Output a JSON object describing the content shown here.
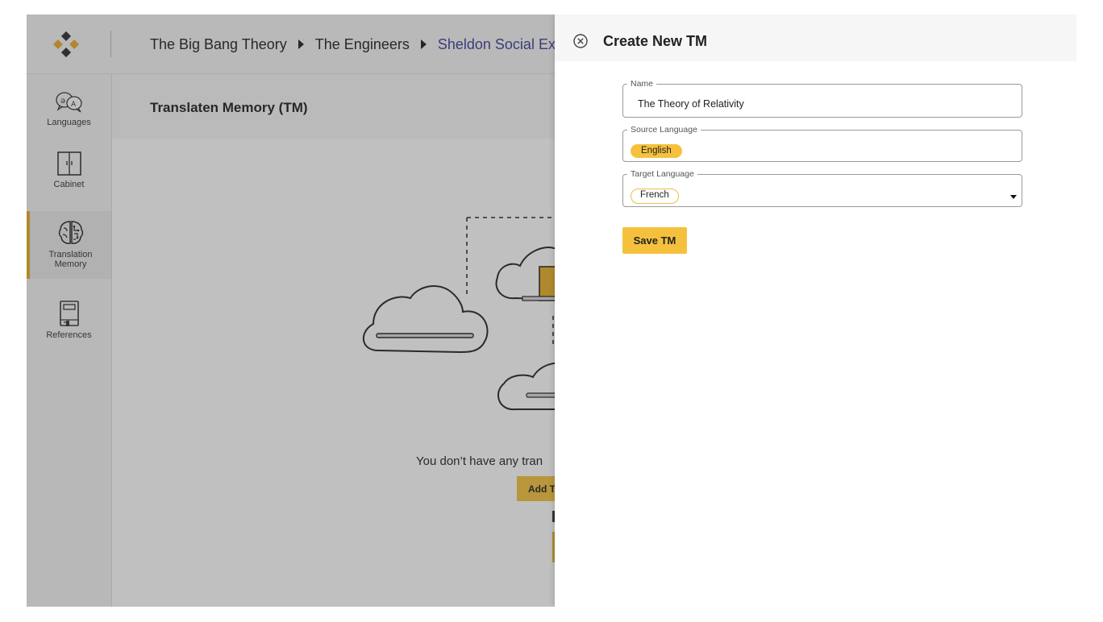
{
  "breadcrumb": {
    "items": [
      "The Big Bang Theory",
      "The Engineers",
      "Sheldon Social Ex"
    ]
  },
  "sidebar": {
    "items": [
      {
        "label": "Languages",
        "icon": "languages-icon"
      },
      {
        "label": "Cabinet",
        "icon": "cabinet-icon"
      },
      {
        "label": "Translation Memory",
        "icon": "brain-circuit-icon",
        "active": true
      },
      {
        "label": "References",
        "icon": "book-icon"
      }
    ]
  },
  "content": {
    "title": "Translaten Memory (TM)",
    "empty_text": "You don’t have any tran",
    "add_button_label": "Add T"
  },
  "drawer": {
    "title": "Create New TM",
    "fields": {
      "name": {
        "label": "Name",
        "value": "The Theory of Relativity"
      },
      "source_language": {
        "label": "Source Language",
        "value": "English"
      },
      "target_language": {
        "label": "Target Language",
        "value": "French"
      }
    },
    "save_label": "Save TM"
  },
  "colors": {
    "accent": "#f5c13d",
    "breadcrumb_active": "#3d3c96",
    "overlay": "rgba(60,60,60,0.32)"
  }
}
